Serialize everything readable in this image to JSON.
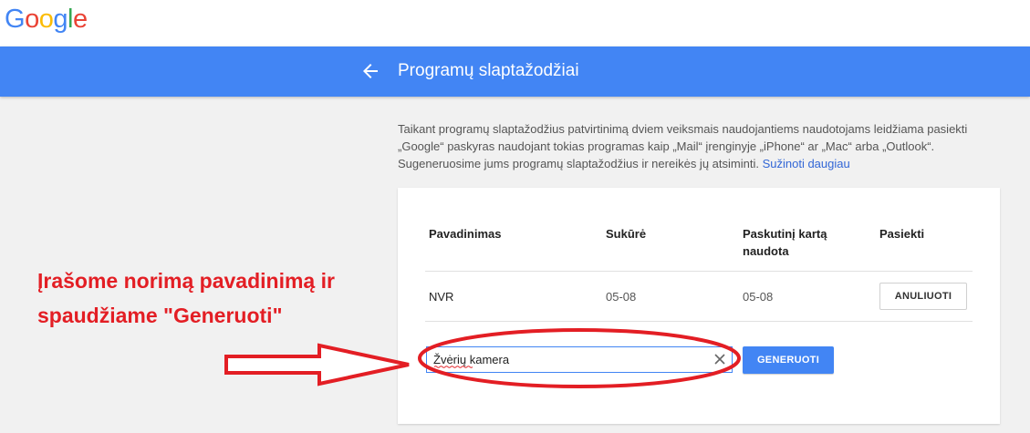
{
  "logo": {
    "letters": [
      "G",
      "o",
      "o",
      "g",
      "l",
      "e"
    ]
  },
  "header": {
    "title": "Programų slaptažodžiai",
    "back_icon": "arrow-back-icon"
  },
  "intro": {
    "text": "Taikant programų slaptažodžius patvirtinimą dviem veiksmais naudojantiems naudotojams leidžiama pasiekti „Google“ paskyras naudojant tokias programas kaip „Mail“ įrenginyje „iPhone“ ar „Mac“ arba „Outlook“. Sugeneruosime jums programų slaptažodžius ir nereikės jų atsiminti. ",
    "link": "Sužinoti daugiau"
  },
  "table": {
    "headers": {
      "name": "Pavadinimas",
      "created": "Sukūrė",
      "last_used": "Paskutinį kartą naudota",
      "access": "Pasiekti"
    },
    "rows": [
      {
        "name": "NVR",
        "created": "05-08",
        "last_used": "05-08",
        "action": "ANULIUOTI"
      }
    ]
  },
  "new_password": {
    "input_value": "Žvėrių kamera",
    "clear_icon": "close-icon",
    "generate_label": "GENERUOTI"
  },
  "annotation": {
    "text": "Įrašome norimą pavadinimą ir spaudžiame \"Generuoti\""
  },
  "colors": {
    "brand_blue": "#4285f4",
    "annotation_red": "#e31e24",
    "link_blue": "#3367d6"
  }
}
